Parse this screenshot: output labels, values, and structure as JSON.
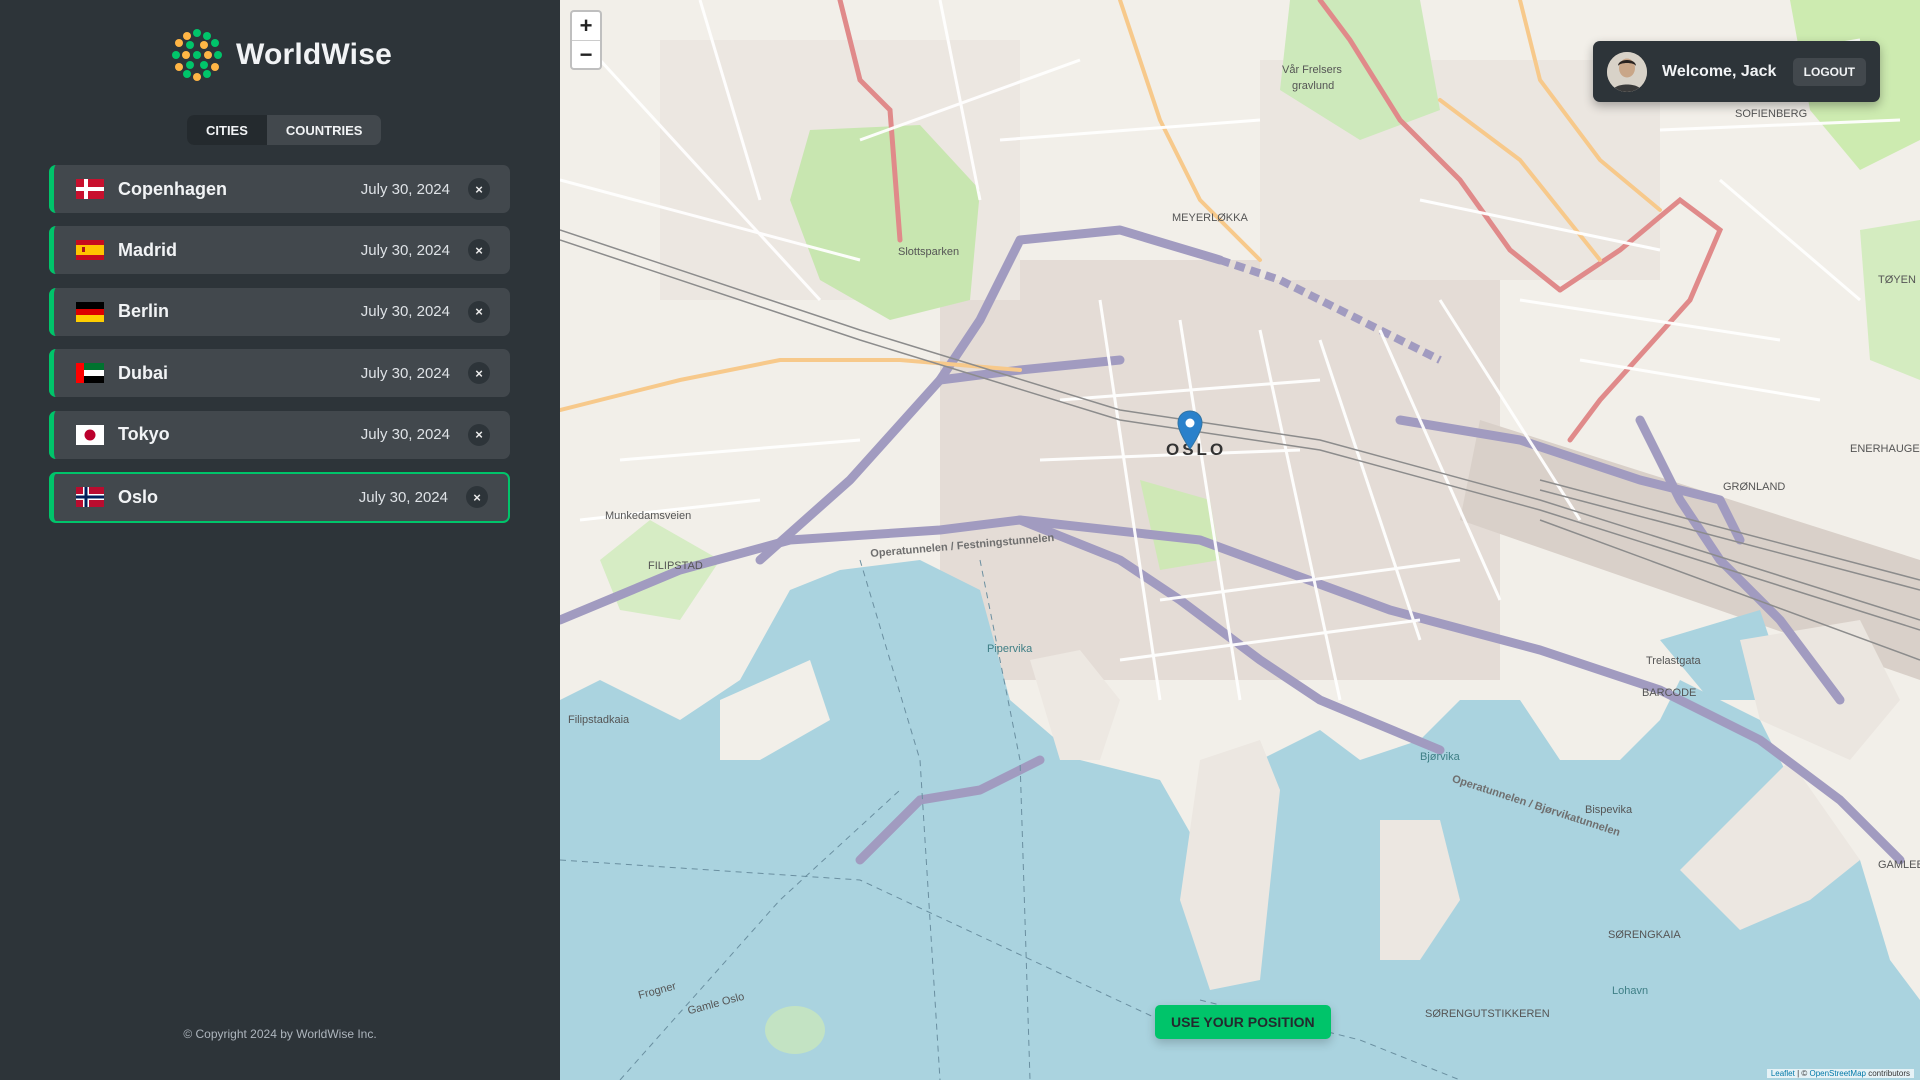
{
  "app": {
    "name": "WorldWise"
  },
  "nav": {
    "tabs": [
      {
        "label": "Cities",
        "active": true
      },
      {
        "label": "Countries",
        "active": false
      }
    ]
  },
  "cities": [
    {
      "name": "Copenhagen",
      "date": "July 30, 2024",
      "flag": "Denmark",
      "active": false
    },
    {
      "name": "Madrid",
      "date": "July 30, 2024",
      "flag": "Spain",
      "active": false
    },
    {
      "name": "Berlin",
      "date": "July 30, 2024",
      "flag": "Germany",
      "active": false
    },
    {
      "name": "Dubai",
      "date": "July 30, 2024",
      "flag": "United Arab Emirates",
      "active": false
    },
    {
      "name": "Tokyo",
      "date": "July 30, 2024",
      "flag": "Japan",
      "active": false
    },
    {
      "name": "Oslo",
      "date": "July 30, 2024",
      "flag": "Norway",
      "active": true
    }
  ],
  "delete_symbol": "×",
  "footer": {
    "copyright": "© Copyright 2024 by WorldWise Inc."
  },
  "map": {
    "zoom_in": "+",
    "zoom_out": "−",
    "city_label": "OSLO",
    "labels": {
      "slottsparken": "Slottsparken",
      "meyerlokka": "MEYERLØKKA",
      "var_frelsers": "Vår Frelsers",
      "gravlund": "gravlund",
      "sofienberg": "SOFIENBERG",
      "toyen": "TØYEN",
      "gronland": "GRØNLAND",
      "filipstad": "FILIPSTAD",
      "pipervika": "Pipervika",
      "bjorvika": "Bjørvika",
      "bispevika": "Bispevika",
      "barcode": "BARCODE",
      "sorenga": "SØRENGKAIA",
      "sorenga_tikk": "SØRENGUTSTIKKEREN",
      "lohavn": "Lohavn",
      "operatunnelen": "Operatunnelen / Festningstunnelen",
      "operatunnelen2": "Operatunnelen / Bjørvikatunnelen",
      "munkedamsveien": "Munkedamsveien",
      "filipstadkaia": "Filipstadkaia",
      "frognerveien": "Frogner",
      "gamle_oslo": "Gamle Oslo",
      "trelastgata": "Trelastgata",
      "enerhaugen": "ENERHAUGEN",
      "gamlebyen": "GAMLEB"
    },
    "attribution": {
      "leaflet": "Leaflet",
      "separator": " | © ",
      "osm": "OpenStreetMap",
      "suffix": " contributors"
    }
  },
  "user": {
    "welcome": "Welcome, Jack",
    "logout": "Logout"
  },
  "position_button": "Use your position",
  "colors": {
    "brand_green": "#00c46a",
    "sidebar_bg": "#2d3439",
    "item_bg": "#42484d",
    "water": "#aad3df"
  }
}
